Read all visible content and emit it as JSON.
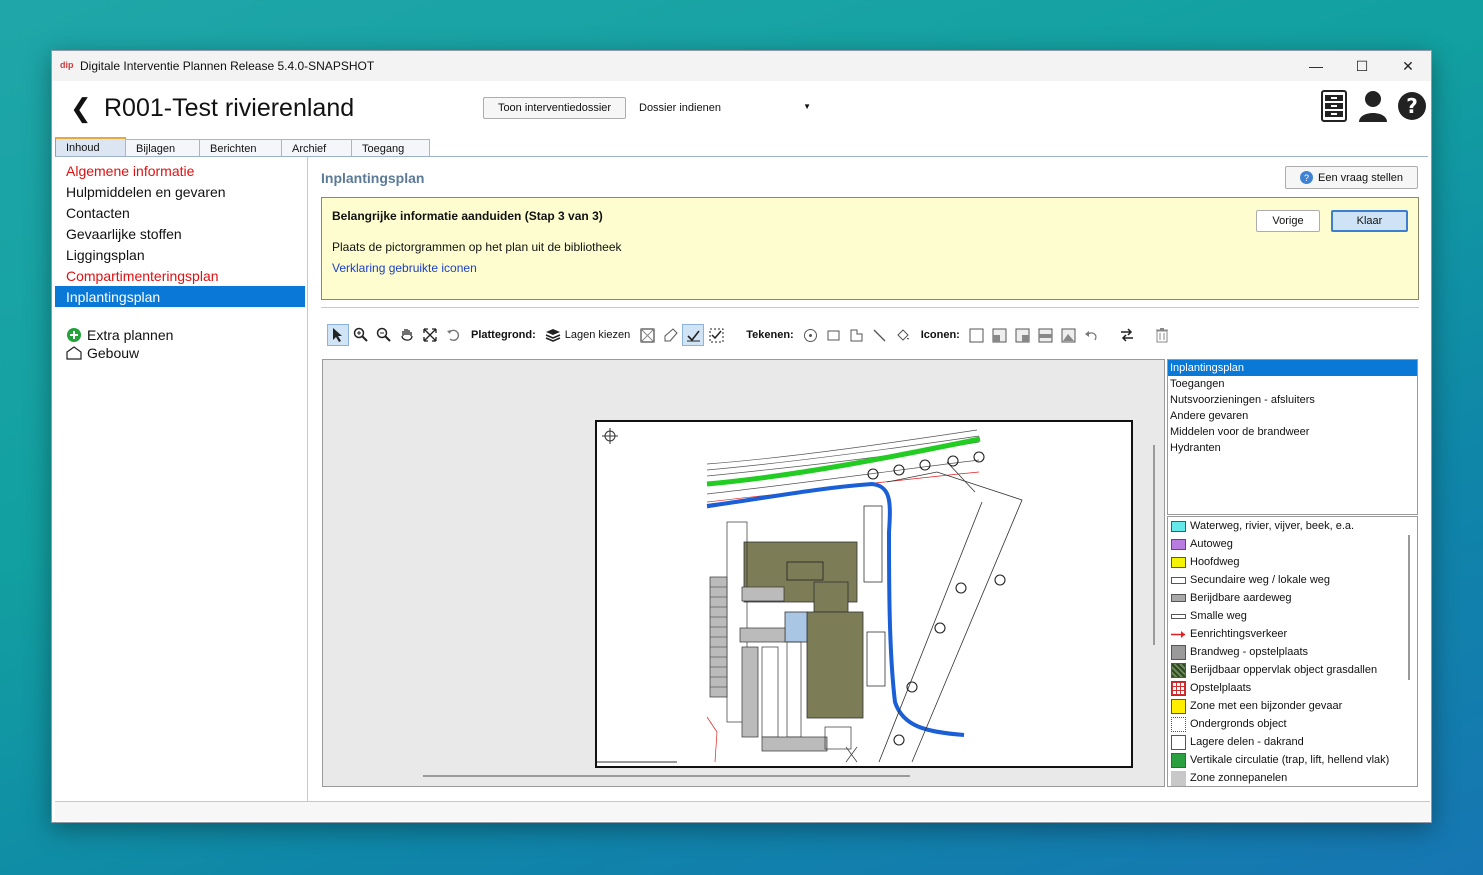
{
  "window": {
    "title": "Digitale Interventie Plannen Release 5.4.0-SNAPSHOT",
    "logo_text": "dip"
  },
  "header": {
    "title": "R001-Test rivierenland",
    "toon_button": "Toon interventiedossier",
    "dossier_select": "Dossier indienen"
  },
  "tabs": [
    {
      "label": "Inhoud",
      "active": true
    },
    {
      "label": "Bijlagen"
    },
    {
      "label": "Berichten"
    },
    {
      "label": "Archief"
    },
    {
      "label": "Toegang"
    }
  ],
  "sidebar": {
    "items": [
      {
        "label": "Algemene informatie",
        "color": "#e01010"
      },
      {
        "label": "Hulpmiddelen en gevaren"
      },
      {
        "label": "Contacten"
      },
      {
        "label": "Gevaarlijke stoffen"
      },
      {
        "label": "Liggingsplan"
      },
      {
        "label": "Compartimenteringsplan",
        "color": "#e01010"
      },
      {
        "label": "Inplantingsplan",
        "selected": true
      }
    ],
    "extra_plannen": "Extra plannen",
    "gebouw": "Gebouw"
  },
  "main": {
    "section_title": "Inplantingsplan",
    "vraag_button": "Een vraag stellen",
    "info": {
      "title": "Belangrijke informatie aanduiden (Stap 3 van 3)",
      "text": "Plaats de pictorgrammen op het plan uit de bibliotheek",
      "link": "Verklaring gebruikte iconen",
      "vorige": "Vorige",
      "klaar": "Klaar"
    },
    "toolbar": {
      "plattegrond": "Plattegrond:",
      "lagen_kiezen": "Lagen kiezen",
      "tekenen": "Tekenen:",
      "iconen": "Iconen:"
    },
    "layers": [
      {
        "label": "Inplantingsplan",
        "selected": true
      },
      {
        "label": "Toegangen"
      },
      {
        "label": "Nutsvoorzieningen - afsluiters"
      },
      {
        "label": "Andere gevaren"
      },
      {
        "label": "Middelen voor de brandweer"
      },
      {
        "label": "Hydranten"
      }
    ],
    "legend": [
      {
        "label": "Waterweg, rivier, vijver, beek, e.a.",
        "color": "#66e8e8"
      },
      {
        "label": "Autoweg",
        "color": "#b87be0"
      },
      {
        "label": "Hoofdweg",
        "color": "#f4f400"
      },
      {
        "label": "Secundaire weg / lokale weg",
        "color": "#ffffff"
      },
      {
        "label": "Berijdbare aardeweg",
        "color": "#a8a8a8"
      },
      {
        "label": "Smalle weg",
        "color": "#ffffff"
      },
      {
        "label": "Eenrichtingsverkeer",
        "color": "#e02020"
      },
      {
        "label": "Brandweg - opstelplaats",
        "color": "#9a9a9a"
      },
      {
        "label": "Berijdbaar oppervlak object grasdallen",
        "color": "#4a6a3a"
      },
      {
        "label": "Opstelplaats",
        "color": "#d03030"
      },
      {
        "label": "Zone met een bijzonder gevaar",
        "color": "#ffee00"
      },
      {
        "label": "Ondergronds object",
        "color": "#ffffff"
      },
      {
        "label": "Lagere delen - dakrand",
        "color": "#ffffff"
      },
      {
        "label": "Vertikale circulatie (trap, lift, hellend vlak)",
        "color": "#2aa040"
      },
      {
        "label": "Zone zonnepanelen",
        "color": "#c8c8c8"
      }
    ]
  }
}
